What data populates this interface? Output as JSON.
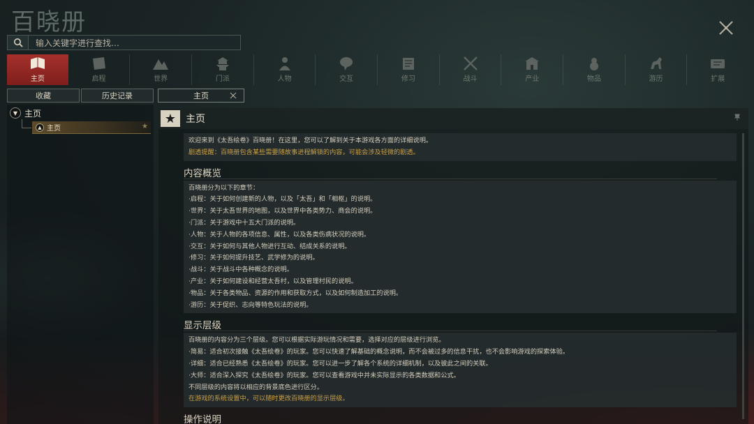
{
  "app": {
    "title": "百晓册"
  },
  "search": {
    "placeholder": "输入关键字进行查找…"
  },
  "categories": [
    {
      "label": "主页",
      "icon": "book-scroll-icon",
      "active": true
    },
    {
      "label": "启程",
      "icon": "map-scroll-icon"
    },
    {
      "label": "世界",
      "icon": "mountain-icon"
    },
    {
      "label": "门派",
      "icon": "pagoda-icon"
    },
    {
      "label": "人物",
      "icon": "person-icon"
    },
    {
      "label": "交互",
      "icon": "speech-mask-icon"
    },
    {
      "label": "修习",
      "icon": "study-icon"
    },
    {
      "label": "战斗",
      "icon": "crossed-swords-icon"
    },
    {
      "label": "产业",
      "icon": "building-icon"
    },
    {
      "label": "物品",
      "icon": "gourd-icon"
    },
    {
      "label": "游历",
      "icon": "horse-icon"
    },
    {
      "label": "扩展",
      "icon": "expansion-icon"
    }
  ],
  "tabs": {
    "favorites": "收藏",
    "history": "历史记录",
    "open_page": "主页"
  },
  "tree": {
    "root": "主页",
    "child": "主页"
  },
  "main": {
    "title": "主页",
    "intro": "欢迎来到《太吾绘卷》百晓册！在这里，您可以了解到关于本游戏各方面的详细说明。",
    "spoiler": "剧透提醒：百晓册包含某些需要随故事进程解锁的内容，可能会涉及轻微的剧透。",
    "sec1": "内容概览",
    "sec1_lines": [
      "百晓册分为以下的章节：",
      "·启程：关于如何创建新的人物，以及「太吾」和「相枢」的说明。",
      "·世界：关于太吾世界的地图，以及世界中各类势力、商会的说明。",
      "·门派：关于游戏中十五大门派的说明。",
      "·人物：关于人物的各项信息、属性，以及各类伤病状况的说明。",
      "·交互：关于如何与其他人物进行互动、结成关系的说明。",
      "·修习：关于如何提升技艺、武学修为的说明。",
      "·战斗：关于战斗中各种概念的说明。",
      "·产业：关于如何建设和经营太吾村，以及管理村民的说明。",
      "·物品：关于各类物品、资源的作用和获取方式，以及如何制造加工的说明。",
      "·游历：关于促织、志向等特色玩法的说明。"
    ],
    "sec2": "显示层级",
    "sec2_lines": [
      "百晓册的内容分为三个层级。您可以根据实际游玩情况和需要，选择对应的层级进行浏览。",
      "·简易：适合初次接触《太吾绘卷》的玩家。您可以快速了解基础的概念说明，而不会被过多的信息干扰，也不会影响游戏的探索体验。",
      "·详细：适合已经熟悉《太吾绘卷》的玩家。您可以进一步了解各个系统的详细机制，以及彼此之间的关联。",
      "·大师：适合深入探究《太吾绘卷》的玩家。您可以查看游戏中并未实际显示的各类数据和公式。",
      "不同层级的内容将以相应的背景底色进行区分。"
    ],
    "sec2_note": "在游戏的系统设置中，可以随时更改百晓册的显示层级。",
    "sec3": "操作说明"
  }
}
